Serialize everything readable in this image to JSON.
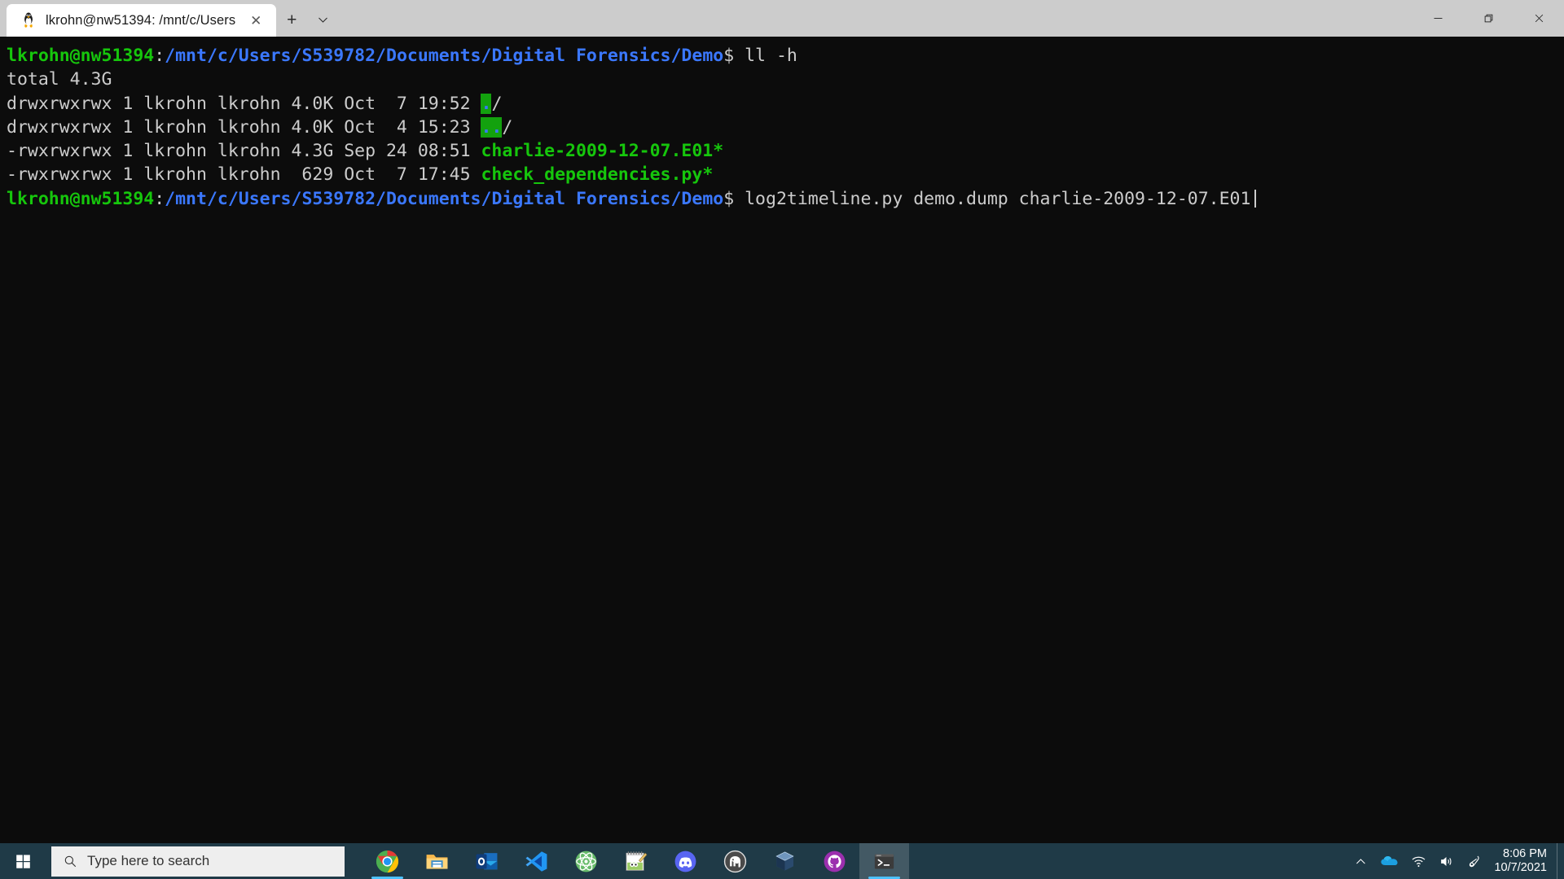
{
  "window": {
    "tab": {
      "icon": "tux-penguin-icon",
      "title": "lkrohn@nw51394: /mnt/c/Users",
      "close_label": "✕"
    },
    "new_tab_label": "+",
    "dropdown_label": "∨",
    "controls": {
      "minimize": "—",
      "restore": "❐",
      "close": "✕"
    }
  },
  "terminal": {
    "prompt_user_host": "lkrohn@nw51394",
    "prompt_colon": ":",
    "prompt_path": "/mnt/c/Users/S539782/Documents/Digital Forensics/Demo",
    "prompt_symbol": "$",
    "lines": [
      {
        "type": "prompt",
        "command": " ll -h"
      },
      {
        "type": "plain",
        "text": "total 4.3G"
      },
      {
        "type": "listing",
        "perms": "drwxrwxrwx",
        "links": "1",
        "owner": "lkrohn",
        "group": "lkrohn",
        "size": "4.0K",
        "month": "Oct",
        "day": " 7",
        "time": "19:52",
        "name": ".",
        "suffix": "/",
        "style": "dir-highlight"
      },
      {
        "type": "listing",
        "perms": "drwxrwxrwx",
        "links": "1",
        "owner": "lkrohn",
        "group": "lkrohn",
        "size": "4.0K",
        "month": "Oct",
        "day": " 4",
        "time": "15:23",
        "name": "..",
        "suffix": "/",
        "style": "dir-highlight"
      },
      {
        "type": "listing",
        "perms": "-rwxrwxrwx",
        "links": "1",
        "owner": "lkrohn",
        "group": "lkrohn",
        "size": "4.3G",
        "month": "Sep",
        "day": "24",
        "time": "08:51",
        "name": "charlie-2009-12-07.E01",
        "suffix": "*",
        "style": "executable"
      },
      {
        "type": "listing",
        "perms": "-rwxrwxrwx",
        "links": "1",
        "owner": "lkrohn",
        "group": "lkrohn",
        "size": " 629",
        "month": "Oct",
        "day": " 7",
        "time": "17:45",
        "name": "check_dependencies.py",
        "suffix": "*",
        "style": "executable"
      },
      {
        "type": "prompt",
        "command": " log2timeline.py demo.dump charlie-2009-12-07.E01",
        "cursor": true
      }
    ],
    "colors": {
      "background": "#0c0c0c",
      "foreground": "#cccccc",
      "green": "#16c60c",
      "blue": "#3b78ff",
      "dir_highlight_bg": "#13a10e"
    }
  },
  "taskbar": {
    "start_label": "start-button",
    "search": {
      "placeholder": "Type here to search",
      "icon": "search-icon"
    },
    "pinned": [
      {
        "name": "chrome",
        "label": "Google Chrome",
        "active": true
      },
      {
        "name": "file-explorer",
        "label": "File Explorer",
        "active": false
      },
      {
        "name": "outlook",
        "label": "Outlook",
        "active": false
      },
      {
        "name": "vscode",
        "label": "Visual Studio Code",
        "active": false
      },
      {
        "name": "atom",
        "label": "Atom",
        "active": false
      },
      {
        "name": "notepad",
        "label": "Notepad",
        "active": false
      },
      {
        "name": "discord",
        "label": "Discord",
        "active": false
      },
      {
        "name": "mamp",
        "label": "MAMP",
        "active": false
      },
      {
        "name": "virtualbox",
        "label": "VirtualBox",
        "active": false
      },
      {
        "name": "github-desktop",
        "label": "GitHub Desktop",
        "active": false
      },
      {
        "name": "windows-terminal",
        "label": "Windows Terminal",
        "active": true,
        "running": true
      }
    ],
    "tray": [
      {
        "name": "show-hidden-icons",
        "icon": "chevron-up-icon"
      },
      {
        "name": "onedrive",
        "icon": "cloud-icon"
      },
      {
        "name": "network",
        "icon": "wifi-icon"
      },
      {
        "name": "volume",
        "icon": "speaker-icon"
      },
      {
        "name": "pen-menu",
        "icon": "pen-icon"
      }
    ],
    "clock": {
      "time": "8:06 PM",
      "date": "10/7/2021"
    }
  }
}
